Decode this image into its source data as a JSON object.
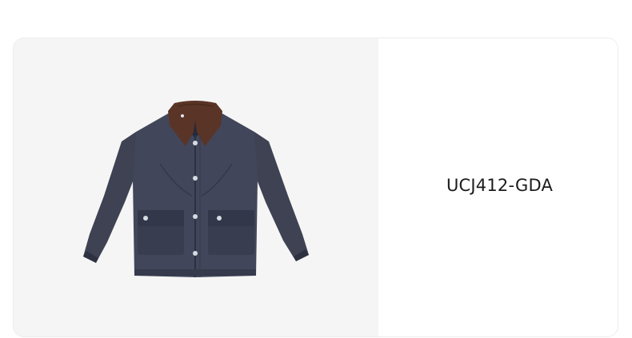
{
  "product": {
    "code": "UCJ412-GDA",
    "image": {
      "icon": "navy-jacket-with-brown-corduroy-collar",
      "colors": {
        "body": "#3e4252",
        "body_dark": "#2a2d3a",
        "collar": "#5a3426",
        "button": "#d8dbe2",
        "background": "#f5f5f5"
      }
    }
  }
}
